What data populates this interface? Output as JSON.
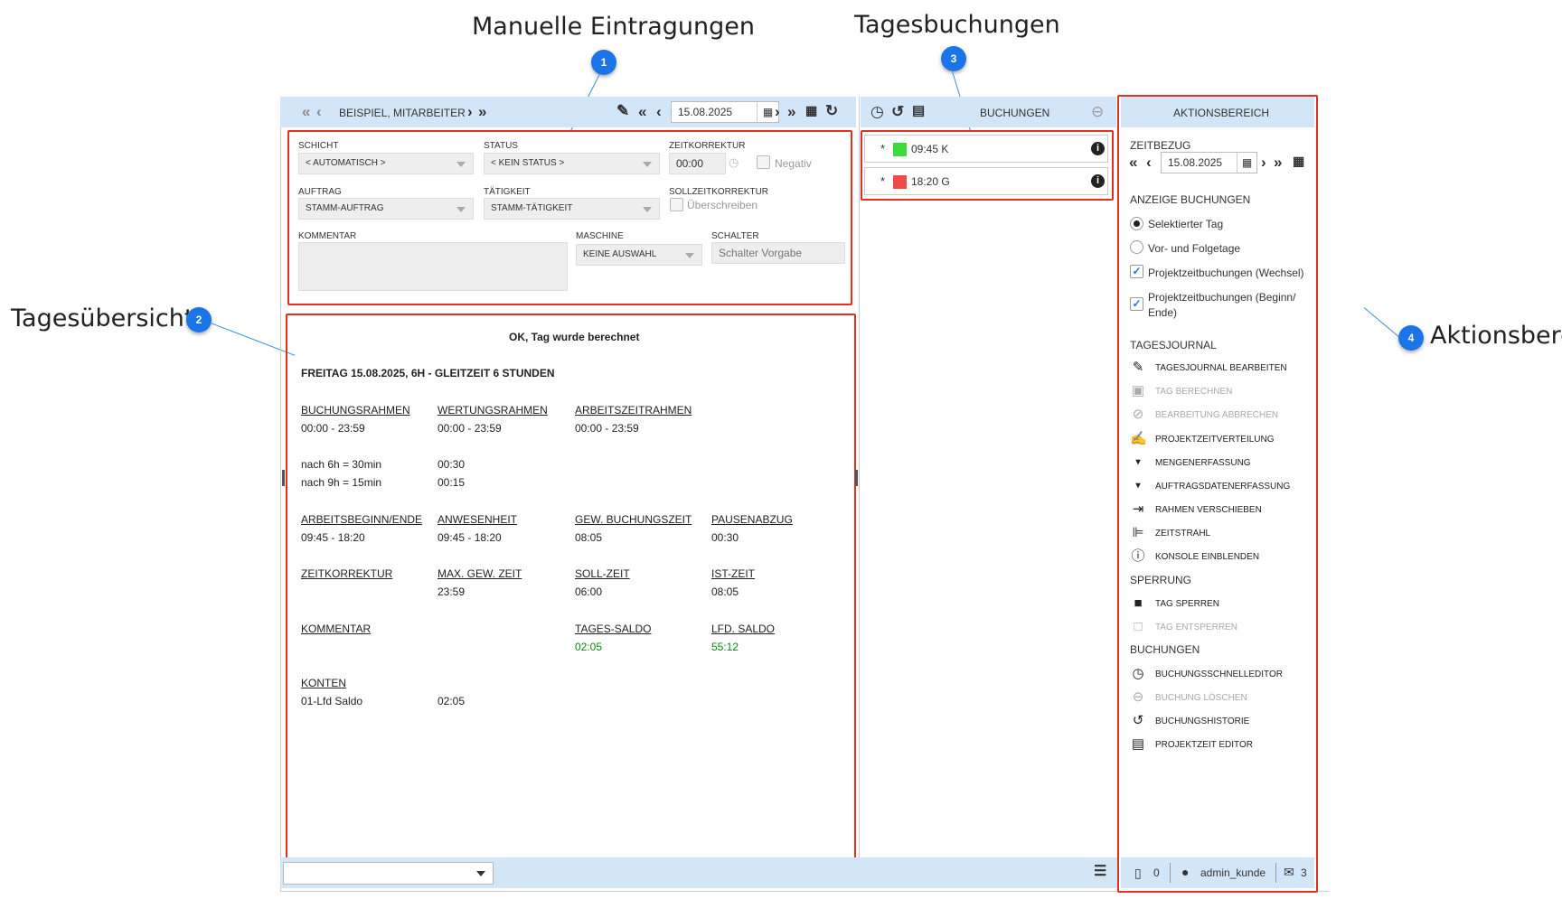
{
  "callouts": {
    "manual": {
      "title": "Manuelle Eintragungen",
      "num": "1"
    },
    "overview": {
      "title": "Tagesübersicht",
      "num": "2"
    },
    "bookings": {
      "title": "Tagesbuchungen",
      "num": "3"
    },
    "actions": {
      "title": "Aktionsbereich",
      "num": "4"
    }
  },
  "header": {
    "employee": "BEISPIEL, MITARBEITER",
    "date": "15.08.2025"
  },
  "form": {
    "shift_label": "SCHICHT",
    "shift_value": "< AUTOMATISCH >",
    "status_label": "STATUS",
    "status_value": "< KEIN STATUS >",
    "timecorr_label": "ZEITKORREKTUR",
    "timecorr_value": "00:00",
    "negative_label": "Negativ",
    "order_label": "AUFTRAG",
    "order_value": "STAMM-AUFTRAG",
    "activity_label": "TÄTIGKEIT",
    "activity_value": "STAMM-TÄTIGKEIT",
    "target_corr_label": "SOLLZEITKORREKTUR",
    "overwrite_label": "Überschreiben",
    "comment_label": "KOMMENTAR",
    "machine_label": "MASCHINE",
    "machine_value": "KEINE AUSWAHL",
    "switch_label": "SCHALTER",
    "switch_placeholder": "Schalter Vorgabe"
  },
  "overview": {
    "status": "OK, Tag wurde berechnet",
    "day": "FREITAG 15.08.2025, 6H - GLEITZEIT 6 STUNDEN",
    "h_booking_frame": "BUCHUNGSRAHMEN",
    "booking_frame": "00:00 - 23:59",
    "h_valuation_frame": "WERTUNGSRAHMEN",
    "valuation_frame": "00:00 - 23:59",
    "h_work_frame": "ARBEITSZEITRAHMEN",
    "work_frame": "00:00 - 23:59",
    "break1_rule": "nach 6h = 30min",
    "break1_value": "00:30",
    "break2_rule": "nach 9h = 15min",
    "break2_value": "00:15",
    "h_work_start_end": "ARBEITSBEGINN/ENDE",
    "work_start_end": "09:45 - 18:20",
    "h_presence": "ANWESENHEIT",
    "presence": "09:45 - 18:20",
    "h_weighted_time": "GEW. BUCHUNGSZEIT",
    "weighted_time": "08:05",
    "h_break_deduction": "PAUSENABZUG",
    "break_deduction": "00:30",
    "h_time_correction": "ZEITKORREKTUR",
    "h_max_weighted": "MAX. GEW. ZEIT",
    "max_weighted": "23:59",
    "h_target_time": "SOLL-ZEIT",
    "target_time": "06:00",
    "h_actual_time": "IST-ZEIT",
    "actual_time": "08:05",
    "h_comment": "KOMMENTAR",
    "h_day_balance": "TAGES-SALDO",
    "day_balance": "02:05",
    "h_running_balance": "LFD. SALDO",
    "running_balance": "55:12",
    "h_accounts": "KONTEN",
    "account_name": "01-Lfd Saldo",
    "account_value": "02:05"
  },
  "bookings": {
    "title": "BUCHUNGEN",
    "items": [
      {
        "marker": "*",
        "time": "09:45 K",
        "color": "#3ddc3d"
      },
      {
        "marker": "*",
        "time": "18:20 G",
        "color": "#ee4b4b"
      }
    ]
  },
  "actions": {
    "title": "AKTIONSBEREICH",
    "time_ref_label": "ZEITBEZUG",
    "date": "15.08.2025",
    "display_label": "ANZEIGE BUCHUNGEN",
    "opt_selected_day": "Selektierter Tag",
    "opt_prev_next": "Vor- und Folgetage",
    "opt_project_change": "Projektzeitbuchungen (Wechsel)",
    "opt_project_begin_end_1": "Projektzeitbuchungen (Beginn/",
    "opt_project_begin_end_2": "Ende)",
    "journal_label": "TAGESJOURNAL",
    "journal_items": [
      "TAGESJOURNAL BEARBEITEN",
      "TAG BERECHNEN",
      "BEARBEITUNG ABBRECHEN",
      "PROJEKTZEITVERTEILUNG",
      "MENGENERFASSUNG",
      "AUFTRAGSDATENERFASSUNG",
      "RAHMEN VERSCHIEBEN",
      "ZEITSTRAHL",
      "KONSOLE EINBLENDEN"
    ],
    "lock_label": "SPERRUNG",
    "lock_items": [
      "TAG SPERREN",
      "TAG ENTSPERREN"
    ],
    "booking_label": "BUCHUNGEN",
    "booking_items": [
      "BUCHUNGSSCHNELLEDITOR",
      "BUCHUNG LÖSCHEN",
      "BUCHUNGSHISTORIE",
      "PROJEKTZEIT EDITOR"
    ]
  },
  "footer": {
    "pdf_count": "0",
    "user": "admin_kunde",
    "mail_count": "3"
  },
  "icons": [
    "double-chevron-left-icon",
    "chevron-left-icon",
    "chevron-right-icon",
    "double-chevron-right-icon",
    "pencil-icon",
    "calendar-icon",
    "refresh-icon",
    "clock-icon",
    "history-icon",
    "clipboard-icon",
    "minus-circle-icon",
    "info-icon",
    "save-icon",
    "cancel-icon",
    "edit-doc-icon",
    "data-icon",
    "move-frame-icon",
    "timeline-icon",
    "alert-icon",
    "lock-icon",
    "unlock-icon",
    "pdf-icon",
    "user-icon",
    "mail-icon",
    "list-icon"
  ]
}
